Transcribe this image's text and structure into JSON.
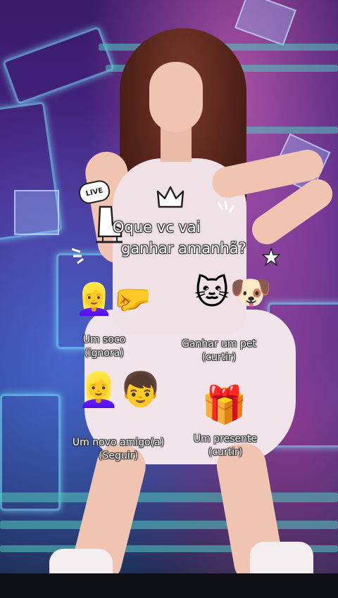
{
  "overlay": {
    "live_badge": "LIVE",
    "title_line1": "Oque vc vai",
    "title_line2": "ganhar amanhã?",
    "options": [
      {
        "line1": "Um soco",
        "line2": "(ignora)",
        "emoji": "👱‍♀️🤛"
      },
      {
        "line1": "Ganhar um pet",
        "line2": "(curtir)",
        "emoji": "🐱🐶"
      },
      {
        "line1": "Um novo amigo(a)",
        "line2": "(Seguir)",
        "emoji": "👱‍♀️👦"
      },
      {
        "line1": "Um presente",
        "line2": "(curtir)",
        "emoji": "🎁"
      }
    ]
  },
  "icons": [
    "crown-icon",
    "ice-skate-icon",
    "star-icon",
    "sparkle-icon",
    "live-badge-icon"
  ]
}
